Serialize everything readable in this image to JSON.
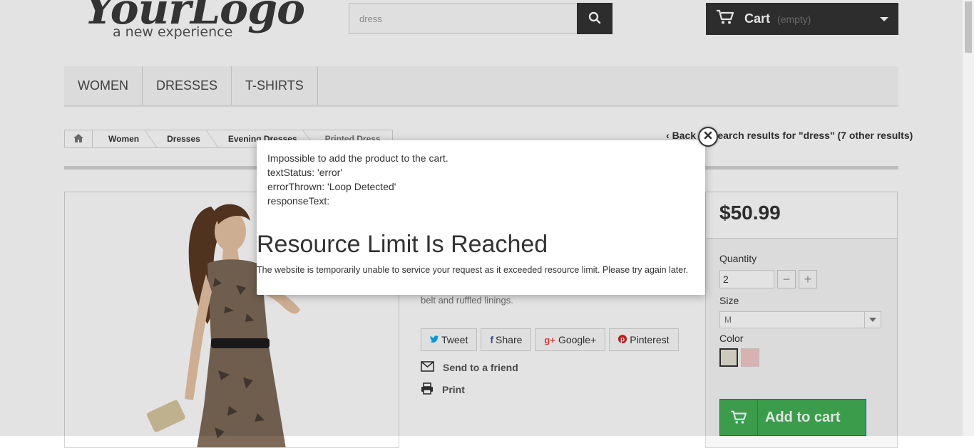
{
  "header": {
    "logo_main": "YourLogo",
    "logo_tagline": "a new experience",
    "search": {
      "value": "dress",
      "icon": "search-icon"
    },
    "cart": {
      "label": "Cart",
      "status": "(empty)",
      "icon": "shopping-cart-icon"
    }
  },
  "menu": {
    "items": [
      {
        "label": "WOMEN"
      },
      {
        "label": "DRESSES"
      },
      {
        "label": "T-SHIRTS"
      }
    ]
  },
  "breadcrumb": {
    "home_icon": "home-icon",
    "items": [
      "Women",
      "Dresses",
      "Evening Dresses",
      "Printed Dress"
    ]
  },
  "back_link": {
    "label": "Back to Search results for \"dress\" (7 other results)"
  },
  "product": {
    "description_tail": "belt and ruffled linings.",
    "share_buttons": [
      {
        "label": "Tweet",
        "icon": "twitter-icon"
      },
      {
        "label": "Share",
        "icon": "facebook-icon"
      },
      {
        "label": "Google+",
        "icon": "google-plus-icon"
      },
      {
        "label": "Pinterest",
        "icon": "pinterest-icon"
      }
    ],
    "send_to_friend": "Send to a friend",
    "print": "Print"
  },
  "buy_box": {
    "price": "$50.99",
    "quantity_label": "Quantity",
    "quantity_value": "2",
    "size_label": "Size",
    "size_value": "M",
    "color_label": "Color",
    "colors": [
      "#e8e3d3",
      "#f3c8c8"
    ],
    "add_to_cart": "Add to cart",
    "accent_color": "#43b155"
  },
  "modal": {
    "lines": [
      "Impossible to add the product to the cart.",
      "textStatus: 'error'",
      "errorThrown: 'Loop Detected'",
      "responseText:"
    ],
    "heading": "Resource Limit Is Reached",
    "message": "The website is temporarily unable to service your request as it exceeded resource limit. Please try again later."
  }
}
